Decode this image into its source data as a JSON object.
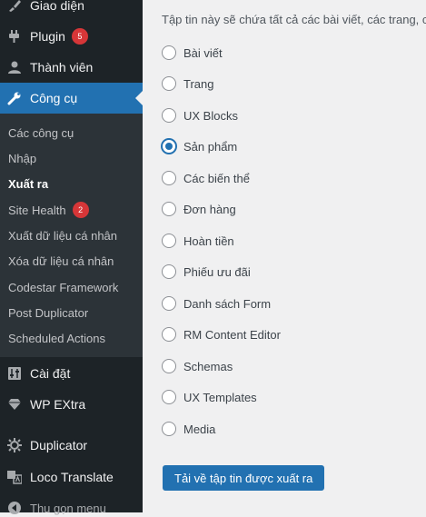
{
  "sidebar": {
    "menu_top": [
      {
        "label": "Giao diện",
        "icon": "brush-icon"
      },
      {
        "label": "Plugin",
        "icon": "plugin-icon",
        "badge": "5"
      },
      {
        "label": "Thành viên",
        "icon": "users-icon"
      },
      {
        "label": "Công cụ",
        "icon": "wrench-icon",
        "active": true
      }
    ],
    "submenu": [
      {
        "label": "Các công cụ"
      },
      {
        "label": "Nhập"
      },
      {
        "label": "Xuất ra",
        "current": true
      },
      {
        "label": "Site Health",
        "badge": "2"
      },
      {
        "label": "Xuất dữ liệu cá nhân"
      },
      {
        "label": "Xóa dữ liệu cá nhân"
      },
      {
        "label": "Codestar Framework"
      },
      {
        "label": "Post Duplicator"
      },
      {
        "label": "Scheduled Actions"
      }
    ],
    "menu_bottom": [
      {
        "label": "Cài đặt",
        "icon": "settings-icon"
      },
      {
        "label": "WP EXtra",
        "icon": "diamond-icon"
      },
      {
        "label": "Duplicator",
        "icon": "duplicator-icon"
      },
      {
        "label": "Loco Translate",
        "icon": "translate-icon"
      }
    ],
    "collapse_label": "Thu gọn menu"
  },
  "main": {
    "intro_text": "Tập tin này sẽ chứa tất cả các bài viết, các trang, các",
    "export_options": [
      {
        "label": "Bài viết",
        "checked": false
      },
      {
        "label": "Trang",
        "checked": false
      },
      {
        "label": "UX Blocks",
        "checked": false
      },
      {
        "label": "Sản phẩm",
        "checked": true
      },
      {
        "label": "Các biến thể",
        "checked": false
      },
      {
        "label": "Đơn hàng",
        "checked": false
      },
      {
        "label": "Hoàn tiền",
        "checked": false
      },
      {
        "label": "Phiếu ưu đãi",
        "checked": false
      },
      {
        "label": "Danh sách Form",
        "checked": false
      },
      {
        "label": "RM Content Editor",
        "checked": false
      },
      {
        "label": "Schemas",
        "checked": false
      },
      {
        "label": "UX Templates",
        "checked": false
      },
      {
        "label": "Media",
        "checked": false
      }
    ],
    "download_button_label": "Tải về tập tin được xuất ra"
  },
  "colors": {
    "sidebar_bg": "#1d2327",
    "submenu_bg": "#2c3338",
    "accent": "#2271b1",
    "badge": "#d63638",
    "content_bg": "#f0f0f1"
  }
}
